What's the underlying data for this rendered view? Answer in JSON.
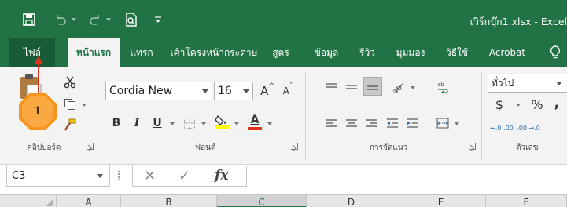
{
  "window": {
    "title": "เวิร์กบุ๊ก1.xlsx - Excel"
  },
  "ribbon_tabs": [
    {
      "label": "ไฟล์"
    },
    {
      "label": "หน้าแรก"
    },
    {
      "label": "แทรก"
    },
    {
      "label": "เค้าโครงหน้ากระดาษ"
    },
    {
      "label": "สูตร"
    },
    {
      "label": "ข้อมูล"
    },
    {
      "label": "รีวิว"
    },
    {
      "label": "มุมมอง"
    },
    {
      "label": "วิธีใช้"
    },
    {
      "label": "Acrobat"
    }
  ],
  "active_tab": "หน้าแรก",
  "groups": {
    "clipboard": "คลิปบอร์ด",
    "font": "ฟอนต์",
    "alignment": "การจัดแนว",
    "number": "ตัวเลข"
  },
  "font": {
    "name": "Cordia New",
    "size": "16",
    "bold": "B",
    "italic": "I",
    "underline": "U",
    "grow": "A",
    "shrink": "A",
    "font_color_letter": "A"
  },
  "number": {
    "format": "ทั่วไป",
    "currency": "$",
    "percent": "%",
    "comma": ",",
    "increase_decimal": "←.0 .00",
    "decrease_decimal": ".00 →.0"
  },
  "formula_bar": {
    "name_box": "C3",
    "cancel": "✕",
    "enter": "✓",
    "fx": "fx",
    "formula": ""
  },
  "columns": [
    "A",
    "B",
    "C",
    "D",
    "E",
    "F"
  ],
  "selected_column": "C",
  "callout": {
    "number": "1"
  },
  "colors": {
    "excel_green": "#217346",
    "file_tab": "#185c37",
    "callout_orange": "#f7941d",
    "callout_arrow": "#e0301e",
    "font_color_bar": "#e0301e",
    "highlight_bar": "#ffff00"
  }
}
